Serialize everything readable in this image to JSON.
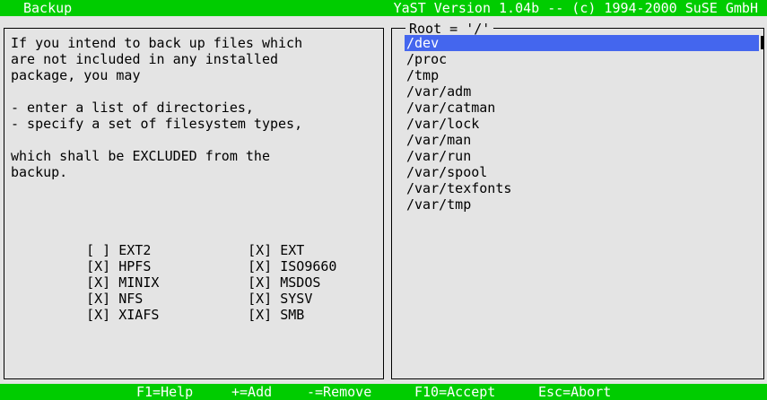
{
  "titlebar": {
    "left": "Backup",
    "right": "YaST Version 1.04b -- (c) 1994-2000 SuSE GmbH"
  },
  "info": {
    "lines": [
      "If you intend to back up files which",
      "are not included in any installed",
      "package, you may",
      "",
      "- enter a list of directories,",
      "- specify a set of filesystem types,",
      "",
      "which shall be EXCLUDED from the",
      "backup."
    ]
  },
  "filesystems": [
    {
      "mark": "[ ]",
      "label": "EXT2",
      "checked": false
    },
    {
      "mark": "[X]",
      "label": "EXT",
      "checked": true
    },
    {
      "mark": "[X]",
      "label": "HPFS",
      "checked": true
    },
    {
      "mark": "[X]",
      "label": "ISO9660",
      "checked": true
    },
    {
      "mark": "[X]",
      "label": "MINIX",
      "checked": true
    },
    {
      "mark": "[X]",
      "label": "MSDOS",
      "checked": true
    },
    {
      "mark": "[X]",
      "label": "NFS",
      "checked": true
    },
    {
      "mark": "[X]",
      "label": "SYSV",
      "checked": true
    },
    {
      "mark": "[X]",
      "label": "XIAFS",
      "checked": true
    },
    {
      "mark": "[X]",
      "label": "SMB",
      "checked": true
    }
  ],
  "dirlist": {
    "title": "Root = '/'",
    "items": [
      "/dev",
      "/proc",
      "/tmp",
      "/var/adm",
      "/var/catman",
      "/var/lock",
      "/var/man",
      "/var/run",
      "/var/spool",
      "/var/texfonts",
      "/var/tmp"
    ],
    "selected": "/dev"
  },
  "statusbar": {
    "help": "F1=Help",
    "add": "+=Add",
    "remove": "-=Remove",
    "accept": "F10=Accept",
    "abort": "Esc=Abort"
  },
  "colors": {
    "bar": "#00cc00",
    "background": "#e4e4e4",
    "selection": "#4466ee"
  }
}
